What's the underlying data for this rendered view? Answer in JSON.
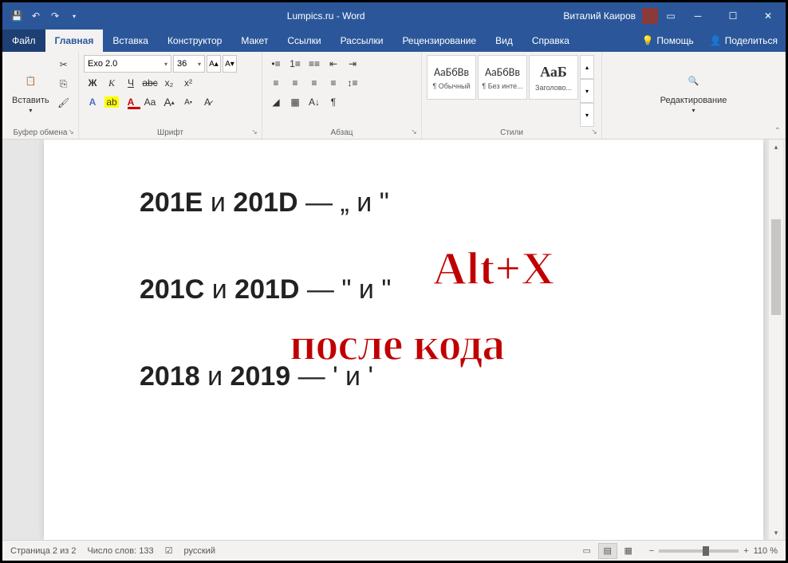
{
  "title": "Lumpics.ru - Word",
  "user": "Виталий Каиров",
  "tabs": {
    "file": "Файл",
    "home": "Главная",
    "insert": "Вставка",
    "design": "Конструктор",
    "layout": "Макет",
    "references": "Ссылки",
    "mailings": "Рассылки",
    "review": "Рецензирование",
    "view": "Вид",
    "help": "Справка",
    "tell": "Помощь",
    "share": "Поделиться"
  },
  "ribbon": {
    "clipboard": {
      "paste": "Вставить",
      "label": "Буфер обмена"
    },
    "font": {
      "name": "Exo 2.0",
      "size": "36",
      "label": "Шрифт",
      "bold": "Ж",
      "italic": "К",
      "under": "Ч",
      "strike": "abc",
      "sub": "x₂",
      "sup": "x²",
      "effects": "A",
      "highlight": "ab",
      "color": "A",
      "case": "Aa",
      "grow": "A",
      "shrink": "A",
      "clear": "A"
    },
    "paragraph": {
      "label": "Абзац"
    },
    "styles": {
      "label": "Стили",
      "items": [
        {
          "preview": "АаБбВв",
          "name": "¶ Обычный"
        },
        {
          "preview": "АаБбВв",
          "name": "¶ Без инте..."
        },
        {
          "preview": "АаБ",
          "name": "Заголово..."
        }
      ]
    },
    "editing": {
      "label": "Редактирование"
    }
  },
  "document": {
    "line1": {
      "c1": "201E",
      "sep": " и ",
      "c2": "201D",
      "dash": " — ",
      "q1": "„",
      "mid": " и ",
      "q2": "\""
    },
    "line2": {
      "c1": "201C",
      "sep": " и ",
      "c2": "201D",
      "dash": " — ",
      "q1": "\"",
      "mid": " и ",
      "q2": "\""
    },
    "line3": {
      "c1": "2018",
      "sep": " и ",
      "c2": "2019",
      "dash": " — ",
      "q1": "'",
      "mid": " и ",
      "q2": "'"
    }
  },
  "overlay": {
    "l1": "Alt+X",
    "l2": "после кода"
  },
  "status": {
    "page": "Страница 2 из 2",
    "words": "Число слов: 133",
    "lang": "русский",
    "zoom_minus": "−",
    "zoom_plus": "+",
    "zoom": "110 %"
  }
}
